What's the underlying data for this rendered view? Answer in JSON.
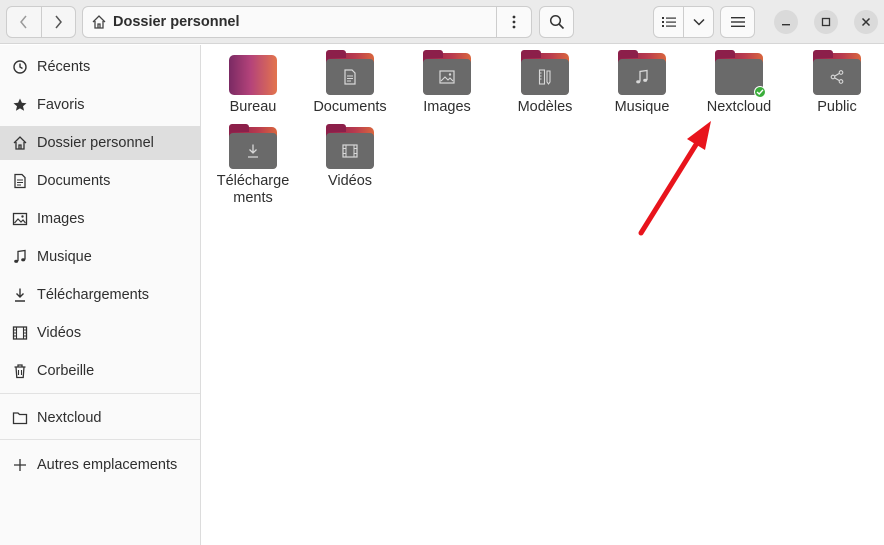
{
  "header": {
    "back_icon": "chevron-left-icon",
    "forward_icon": "chevron-right-icon",
    "path_label": "Dossier personnel",
    "path_icon": "home-icon",
    "path_menu_icon": "vertical-dots-icon",
    "search_icon": "search-icon",
    "view_icon": "list-view-icon",
    "view_dropdown_icon": "chevron-down-icon",
    "menu_icon": "hamburger-menu-icon",
    "window_controls": [
      "minimize-icon",
      "maximize-icon",
      "close-icon"
    ]
  },
  "sidebar": {
    "items": [
      {
        "label": "Récents",
        "icon": "clock-icon"
      },
      {
        "label": "Favoris",
        "icon": "star-icon"
      },
      {
        "label": "Dossier personnel",
        "icon": "home-icon",
        "active": true
      },
      {
        "label": "Documents",
        "icon": "document-icon"
      },
      {
        "label": "Images",
        "icon": "image-icon"
      },
      {
        "label": "Musique",
        "icon": "music-icon"
      },
      {
        "label": "Téléchargements",
        "icon": "download-icon"
      },
      {
        "label": "Vidéos",
        "icon": "film-icon"
      },
      {
        "label": "Corbeille",
        "icon": "trash-icon"
      },
      {
        "label": "Nextcloud",
        "icon": "folder-icon"
      },
      {
        "label": "Autres emplacements",
        "icon": "plus-icon"
      }
    ]
  },
  "folders": [
    {
      "name": "Bureau",
      "icon": "desktop-folder-icon"
    },
    {
      "name": "Documents",
      "icon": "documents-folder-icon"
    },
    {
      "name": "Images",
      "icon": "pictures-folder-icon"
    },
    {
      "name": "Modèles",
      "icon": "templates-folder-icon"
    },
    {
      "name": "Musique",
      "icon": "music-folder-icon"
    },
    {
      "name": "Nextcloud",
      "icon": "synced-folder-icon",
      "badge": "sync-ok-icon"
    },
    {
      "name": "Public",
      "icon": "public-folder-icon"
    },
    {
      "name": "Télécharge\nments",
      "icon": "downloads-folder-icon"
    },
    {
      "name": "Vidéos",
      "icon": "videos-folder-icon"
    }
  ],
  "annotation": {
    "arrow_color": "#e8141c",
    "points_to": "Nextcloud"
  },
  "colors": {
    "accent": "#8c1f4a",
    "sync_ok": "#3bae3b"
  }
}
